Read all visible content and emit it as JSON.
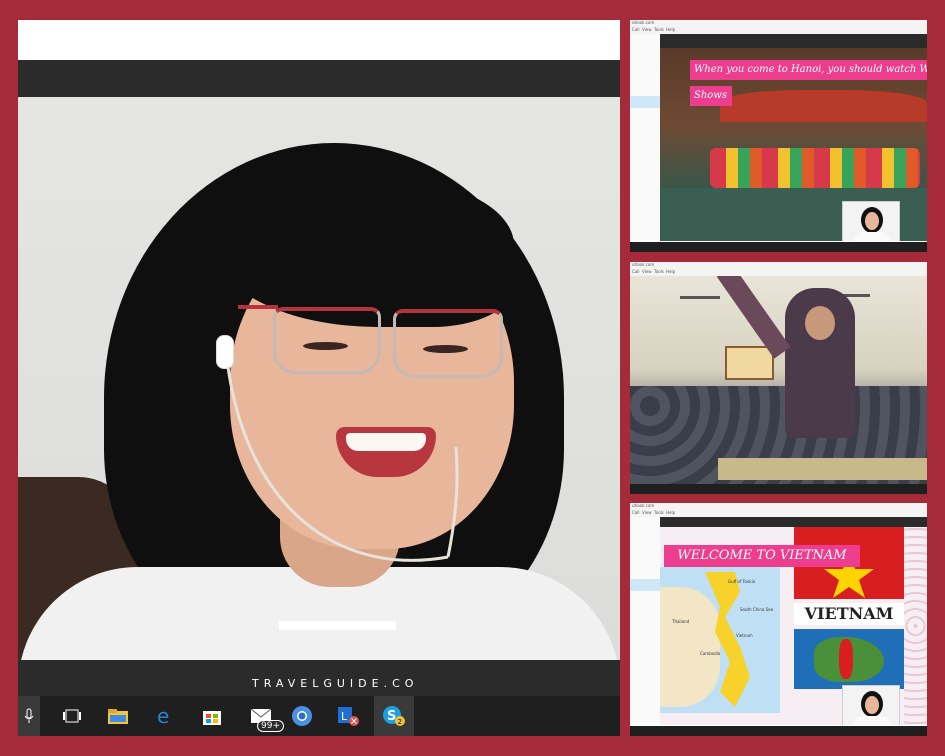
{
  "main": {
    "watermark": "TRAVELGUIDE.CO",
    "taskbar": {
      "icons": [
        {
          "name": "microphone-icon"
        },
        {
          "name": "task-view-icon"
        },
        {
          "name": "file-explorer-icon"
        },
        {
          "name": "edge-icon"
        },
        {
          "name": "store-icon"
        },
        {
          "name": "mail-icon",
          "badge": "99+"
        },
        {
          "name": "chrome-icon"
        },
        {
          "name": "lync-icon"
        },
        {
          "name": "skype-icon",
          "badge": "2"
        }
      ]
    }
  },
  "panel1": {
    "menu_title": "utlook.com",
    "menu_items": [
      "Call",
      "View",
      "Tools",
      "Help"
    ],
    "slide_text_line1": "When you come to Hanoi, you should watch Water",
    "slide_text_line2": "Shows"
  },
  "panel2": {
    "menu_title": "utlook.com",
    "menu_items": [
      "Call",
      "View",
      "Tools",
      "Help"
    ]
  },
  "panel3": {
    "menu_title": "utlook.com",
    "menu_items": [
      "Call",
      "View",
      "Tools",
      "Help"
    ],
    "slide_title": "WELCOME TO VIETNAM",
    "flag_text": "VIETNAM",
    "map_labels": [
      "Gulf of Tonkin",
      "South China Sea",
      "Thailand",
      "Cambodia",
      "Vietnam"
    ]
  },
  "colors": {
    "frame": "#a52a3a",
    "pink_banner": "#ec3d8f",
    "flag_red": "#d81e1e",
    "flag_star": "#ffd400"
  }
}
